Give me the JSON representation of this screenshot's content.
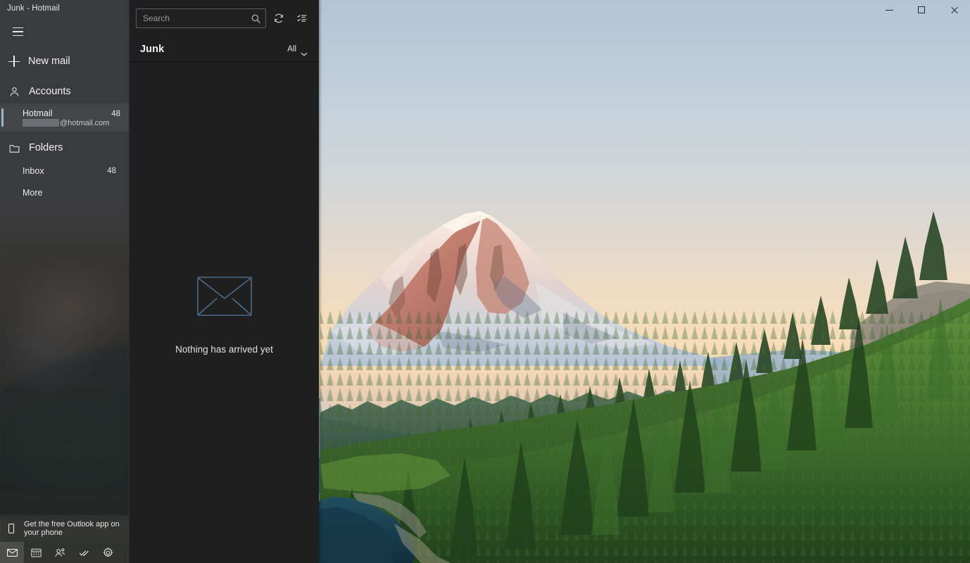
{
  "window": {
    "title": "Junk - Hotmail",
    "controls": [
      {
        "name": "minimize",
        "label": "─"
      },
      {
        "name": "maximize",
        "label": "□"
      },
      {
        "name": "close",
        "label": "✕"
      }
    ]
  },
  "sidebar": {
    "menu_icon": "hamburger-icon",
    "new_mail": {
      "label": "New mail",
      "icon": "plus-icon"
    },
    "accounts": {
      "label": "Accounts",
      "icon": "person-icon"
    },
    "account": {
      "name": "Hotmail",
      "count": "48",
      "email_redacted": true,
      "email_domain": "@hotmail.com",
      "selected": true
    },
    "folders_header": {
      "label": "Folders",
      "icon": "folder-icon"
    },
    "folders": [
      {
        "name": "Inbox",
        "count": "48"
      },
      {
        "name": "More",
        "count": ""
      }
    ],
    "promo": {
      "icon": "phone-icon",
      "line1": "Get the free Outlook app on",
      "line2": "your phone"
    },
    "app_bar": [
      {
        "name": "mail",
        "icon": "mail-icon",
        "active": true
      },
      {
        "name": "calendar",
        "icon": "calendar-icon",
        "active": false
      },
      {
        "name": "people",
        "icon": "people-icon",
        "active": false
      },
      {
        "name": "to-do",
        "icon": "checkmarks-icon",
        "active": false
      },
      {
        "name": "settings",
        "icon": "gear-icon",
        "active": false
      }
    ]
  },
  "list_pane": {
    "search": {
      "placeholder": "Search",
      "value": "",
      "icon": "search-icon"
    },
    "sync_button": {
      "icon": "sync-icon",
      "tooltip": "Sync this view"
    },
    "selection_button": {
      "icon": "selection-mode-icon",
      "tooltip": "Enter selection mode"
    },
    "folder_title": "Junk",
    "filter": {
      "label": "All",
      "icon": "chevron-down-icon"
    },
    "empty_state": {
      "icon": "envelope-outline-icon",
      "message": "Nothing has arrived yet"
    }
  },
  "wallpaper": {
    "scene": "Mount Rainier at sunset with alpenglow, blue layered ridges, dense conifer forest and an alpine lake",
    "colors": {
      "sky_top": "#b3c4d4",
      "sky_mid": "#d2d6d8",
      "sky_horizon": "#f6dcb8",
      "alpenglow": "#c87f6e",
      "snow": "#f0e4e0",
      "snow_shadow": "#8d9eb4",
      "ridge_far": "#93aec4",
      "ridge_mid": "#6f8ca6",
      "ridge_near": "#4d6e84",
      "forest_light": "#5f8f3f",
      "forest_mid": "#3f6b2f",
      "forest_dark": "#23401f",
      "lake": "#1b4453"
    }
  },
  "theme": {
    "nav_bg": "#262626",
    "list_bg": "#1f1f1f",
    "text_primary": "#f2f2f2",
    "text_secondary": "#c9c9c9",
    "selection_accent": "#9db6cc",
    "envelope_stroke": "#486d8d"
  }
}
